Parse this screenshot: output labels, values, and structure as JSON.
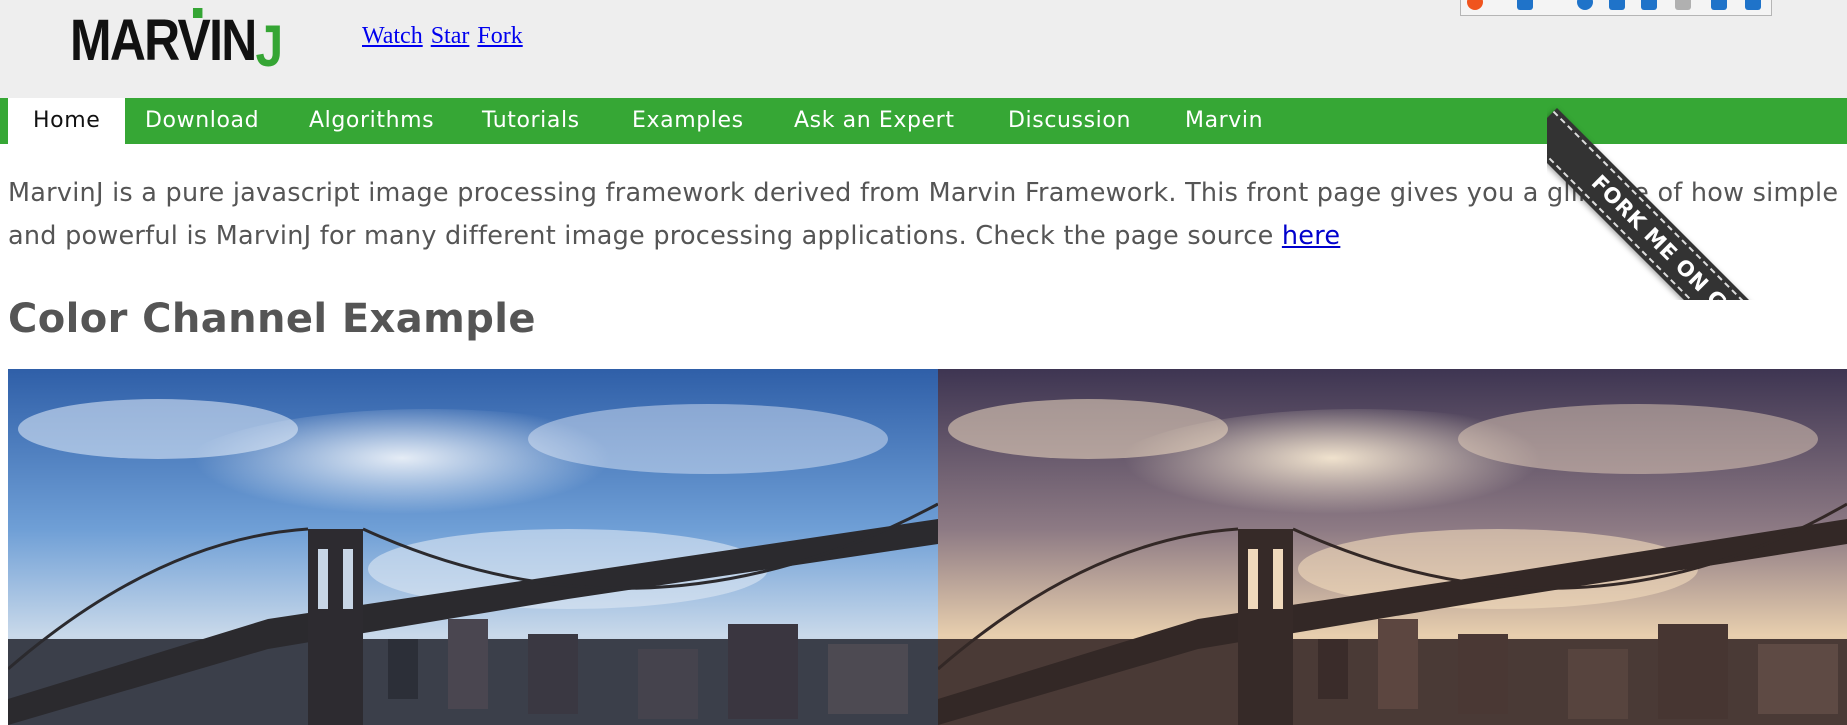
{
  "header": {
    "logo_text": "MARVIN",
    "logo_j": "J",
    "github_links": [
      "Watch",
      "Star",
      "Fork"
    ]
  },
  "nav": {
    "items": [
      {
        "label": "Home",
        "active": true
      },
      {
        "label": "Download"
      },
      {
        "label": "Algorithms"
      },
      {
        "label": "Tutorials"
      },
      {
        "label": "Examples"
      },
      {
        "label": "Ask an Expert"
      },
      {
        "label": "Discussion"
      },
      {
        "label": "Marvin"
      }
    ]
  },
  "intro": {
    "text_line1": "MarvinJ is a pure javascript image processing framework derived from Marvin Framework. This front page gives you a glimpse of how simple",
    "text_line2": "and powerful is MarvinJ for many different image processing applications. Check the page source ",
    "link_text": "here"
  },
  "section": {
    "title": "Color Channel Example"
  },
  "images": {
    "left": "original-bridge-image",
    "right": "color-channel-adjusted-bridge-image"
  },
  "ribbon": {
    "text": "FORK ME ON GITHUB!"
  },
  "colors": {
    "brand_green": "#36a735",
    "header_bg": "#eeeeee",
    "text_gray": "#555555",
    "link_blue": "#0000cc",
    "ribbon_dark": "#333333"
  }
}
